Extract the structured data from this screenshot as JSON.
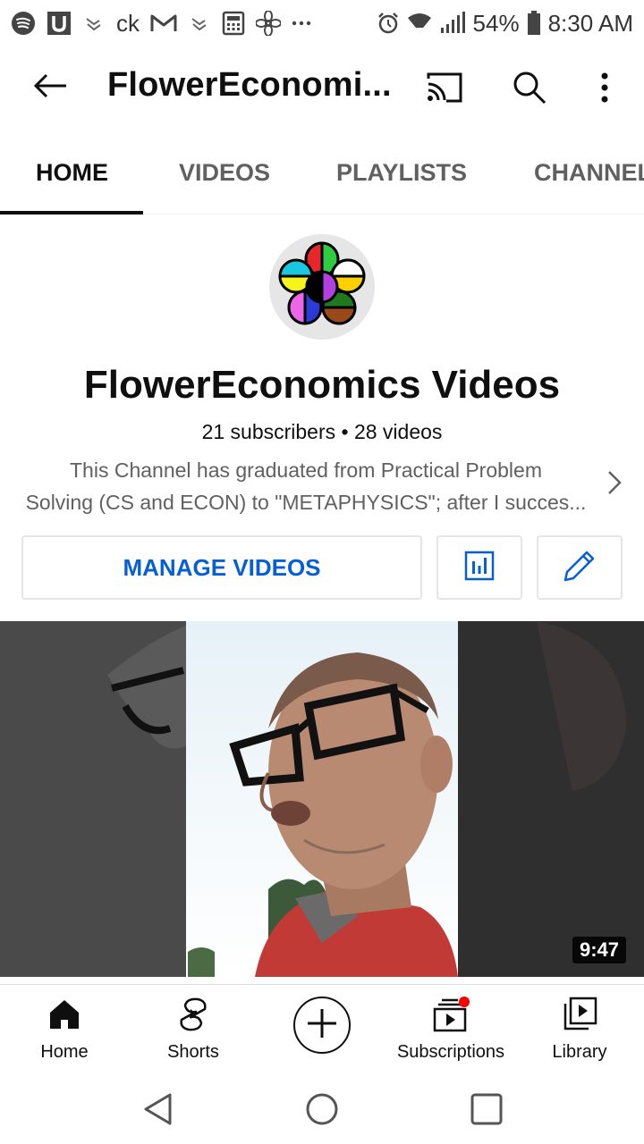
{
  "status_bar": {
    "battery_percent": "54%",
    "time": "8:30 AM",
    "left_text": "ck",
    "icons": [
      "spotify-icon",
      "u-app-icon",
      "hands-icon",
      "gmail-icon",
      "hands-icon",
      "calculator-icon",
      "fan-icon",
      "more-dots-icon",
      "alarm-icon",
      "wifi-icon",
      "signal-icon",
      "battery-icon"
    ]
  },
  "app_bar": {
    "title": "FlowerEconomi...",
    "icons": [
      "back-arrow-icon",
      "cast-icon",
      "search-icon",
      "more-vert-icon"
    ]
  },
  "tabs": [
    {
      "label": "HOME",
      "active": true
    },
    {
      "label": "VIDEOS",
      "active": false
    },
    {
      "label": "PLAYLISTS",
      "active": false
    },
    {
      "label": "CHANNEL",
      "active": false
    }
  ],
  "channel": {
    "name": "FlowerEconomics Videos",
    "stats": "21 subscribers • 28 videos",
    "description_line1": "This Channel has graduated from Practical Problem",
    "description_line2": "Solving (CS and ECON) to \"METAPHYSICS\"; after I succes...",
    "manage_label": "MANAGE VIDEOS",
    "accent_color": "#065fd4"
  },
  "video": {
    "duration": "9:47"
  },
  "bottom_nav": [
    {
      "label": "Home",
      "icon": "home-icon"
    },
    {
      "label": "Shorts",
      "icon": "shorts-icon"
    },
    {
      "label": "",
      "icon": "create-plus-icon"
    },
    {
      "label": "Subscriptions",
      "icon": "subscriptions-icon"
    },
    {
      "label": "Library",
      "icon": "library-icon"
    }
  ],
  "system_nav": {
    "icons": [
      "back-triangle-icon",
      "home-circle-icon",
      "recents-square-icon"
    ]
  }
}
